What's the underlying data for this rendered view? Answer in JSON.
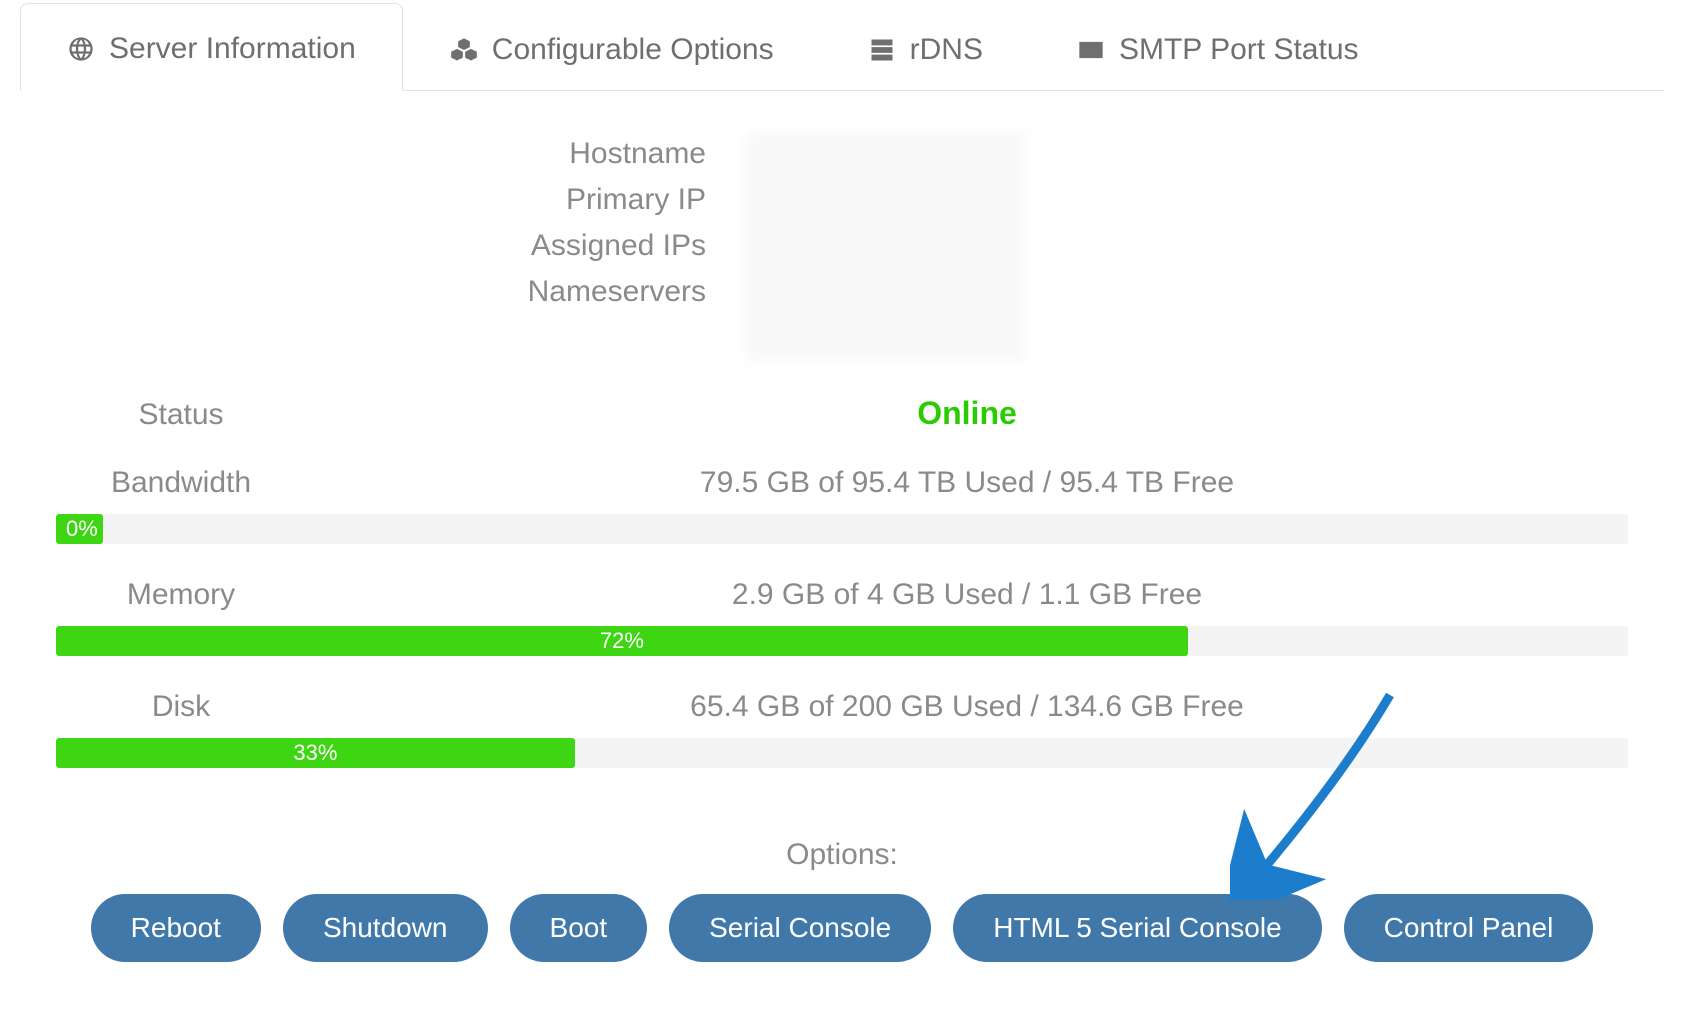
{
  "tabs": [
    {
      "label": "Server Information",
      "icon": "globe-icon",
      "active": true
    },
    {
      "label": "Configurable Options",
      "icon": "cubes-icon",
      "active": false
    },
    {
      "label": "rDNS",
      "icon": "server-icon",
      "active": false
    },
    {
      "label": "SMTP Port Status",
      "icon": "envelope-icon",
      "active": false
    }
  ],
  "info_labels": {
    "hostname": "Hostname",
    "primary_ip": "Primary IP",
    "assigned_ips": "Assigned IPs",
    "nameservers": "Nameservers"
  },
  "status": {
    "label": "Status",
    "value": "Online"
  },
  "metrics": {
    "bandwidth": {
      "label": "Bandwidth",
      "value": "79.5 GB of 95.4 TB Used / 95.4 TB Free",
      "percent": 0,
      "percent_label": "0%"
    },
    "memory": {
      "label": "Memory",
      "value": "2.9 GB of 4 GB Used / 1.1 GB Free",
      "percent": 72,
      "percent_label": "72%"
    },
    "disk": {
      "label": "Disk",
      "value": "65.4 GB of 200 GB Used / 134.6 GB Free",
      "percent": 33,
      "percent_label": "33%"
    }
  },
  "options": {
    "title": "Options:",
    "buttons": [
      "Reboot",
      "Shutdown",
      "Boot",
      "Serial Console",
      "HTML 5 Serial Console",
      "Control Panel"
    ]
  },
  "colors": {
    "accent": "#4078aa",
    "progress": "#3ed613",
    "online": "#28cc00"
  }
}
